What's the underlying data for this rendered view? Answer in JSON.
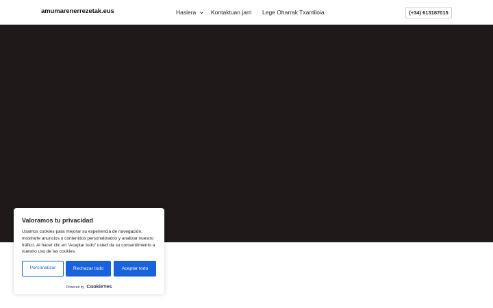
{
  "header": {
    "logo": "amumarenerrezetak.eus",
    "nav": [
      {
        "label": "Hasiera",
        "has_dropdown": true
      },
      {
        "label": "Kontaktuan jarri",
        "has_dropdown": false
      },
      {
        "label": "Lege Oharrak Txantiloia",
        "has_dropdown": false
      }
    ],
    "phone": "(+34) 613187015"
  },
  "hero": {
    "background_color": "#1f1a19"
  },
  "cookie_banner": {
    "title": "Valoramos tu privacidad",
    "text": "Usamos cookies para mejorar su experiencia de navegación, mostrarle anuncios o contenidos personalizados y analizar nuestro tráfico. Al hacer clic en “Aceptar todo” usted da su consentimiento a nuestro uso de las cookies.",
    "buttons": {
      "customize": "Personalizar",
      "reject": "Rechazar todo",
      "accept": "Aceptar todo"
    },
    "powered_by": "Powered by",
    "powered_brand": "CookieYes",
    "accent_color": "#1863dc"
  }
}
